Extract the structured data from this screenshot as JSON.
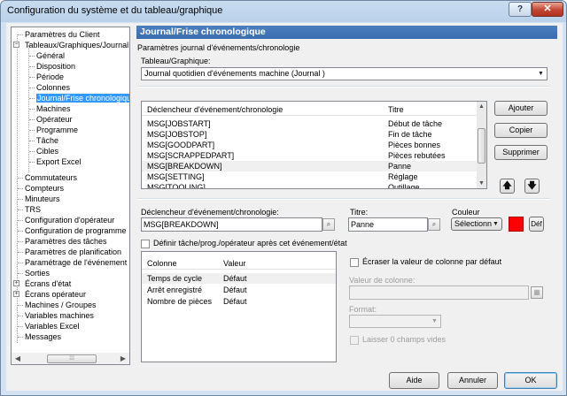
{
  "window": {
    "title": "Configuration du système et du tableau/graphique",
    "help_label": "?",
    "close_label": "✕"
  },
  "tree": {
    "items": [
      {
        "label": "Paramètres du Client"
      },
      {
        "label": "Tableaux/Graphiques/Journal"
      },
      {
        "label": "Général"
      },
      {
        "label": "Disposition"
      },
      {
        "label": "Période"
      },
      {
        "label": "Colonnes"
      },
      {
        "label": "Journal/Frise chronologique",
        "selected": true
      },
      {
        "label": "Machines"
      },
      {
        "label": "Opérateur"
      },
      {
        "label": "Programme"
      },
      {
        "label": "Tâche"
      },
      {
        "label": "Cibles"
      },
      {
        "label": "Export Excel"
      },
      {
        "label": "Commutateurs"
      },
      {
        "label": "Compteurs"
      },
      {
        "label": "Minuteurs"
      },
      {
        "label": "TRS"
      },
      {
        "label": "Configuration d'opérateur"
      },
      {
        "label": "Configuration de programme"
      },
      {
        "label": "Paramètres des tâches"
      },
      {
        "label": "Paramètres de planification"
      },
      {
        "label": "Paramétrage de l'événement"
      },
      {
        "label": "Sorties"
      },
      {
        "label": "Écrans d'état"
      },
      {
        "label": "Écrans opérateur"
      },
      {
        "label": "Machines / Groupes"
      },
      {
        "label": "Variables machines"
      },
      {
        "label": "Variables Excel"
      },
      {
        "label": "Messages"
      }
    ],
    "scroll_left": "◀",
    "scroll_right": "▶",
    "scroll_grip": "⁞⁞⁞"
  },
  "panel": {
    "heading": "Journal/Frise chronologique",
    "section_label": "Paramètres journal d'événements/chronologie",
    "table_label": "Tableau/Graphique:",
    "table_value": "Journal quotidien d'événements machine  (Journal )"
  },
  "events": {
    "columns": [
      "Déclencheur d'événement/chronologie",
      "Titre"
    ],
    "rows": [
      {
        "trigger": "MSG[JOBSTART]",
        "title": "Début de tâche"
      },
      {
        "trigger": "MSG[JOBSTOP]",
        "title": "Fin de tâche"
      },
      {
        "trigger": "MSG[GOODPART]",
        "title": "Pièces bonnes"
      },
      {
        "trigger": "MSG[SCRAPPEDPART]",
        "title": "Pièces rebutées"
      },
      {
        "trigger": "MSG[BREAKDOWN]",
        "title": "Panne"
      },
      {
        "trigger": "MSG[SETTING]",
        "title": "Réglage"
      },
      {
        "trigger": "MSG[TOOLING]",
        "title": "Outillage"
      }
    ]
  },
  "buttons": {
    "add": "Ajouter",
    "copy": "Copier",
    "delete": "Supprimer",
    "up": "🡅",
    "down": "🡇",
    "help": "Aide",
    "cancel": "Annuler",
    "ok": "OK"
  },
  "editor": {
    "trigger_label": "Déclencheur d'événement/chronologie:",
    "trigger_value": "MSG[BREAKDOWN]",
    "title_label": "Titre:",
    "title_value": "Panne",
    "color_label": "Couleur",
    "color_select": "Sélectionn",
    "color_value": "#ff0000",
    "default_label": "Déf",
    "define_checkbox": "Définir tâche/prog./opérateur après cet événement/état",
    "browse_icon": "⌕"
  },
  "columns_table": {
    "headers": [
      "Colonne",
      "Valeur"
    ],
    "rows": [
      {
        "col": "Temps de cycle",
        "val": "Défaut"
      },
      {
        "col": "Arrêt enregistré",
        "val": "Défaut"
      },
      {
        "col": "Nombre de pièces",
        "val": "Défaut"
      }
    ]
  },
  "override": {
    "checkbox_label": "Écraser la valeur de colonne par défaut",
    "value_label": "Valeur de colonne:",
    "format_label": "Format:",
    "blank_zero_label": "Laisser 0 champs vides"
  }
}
